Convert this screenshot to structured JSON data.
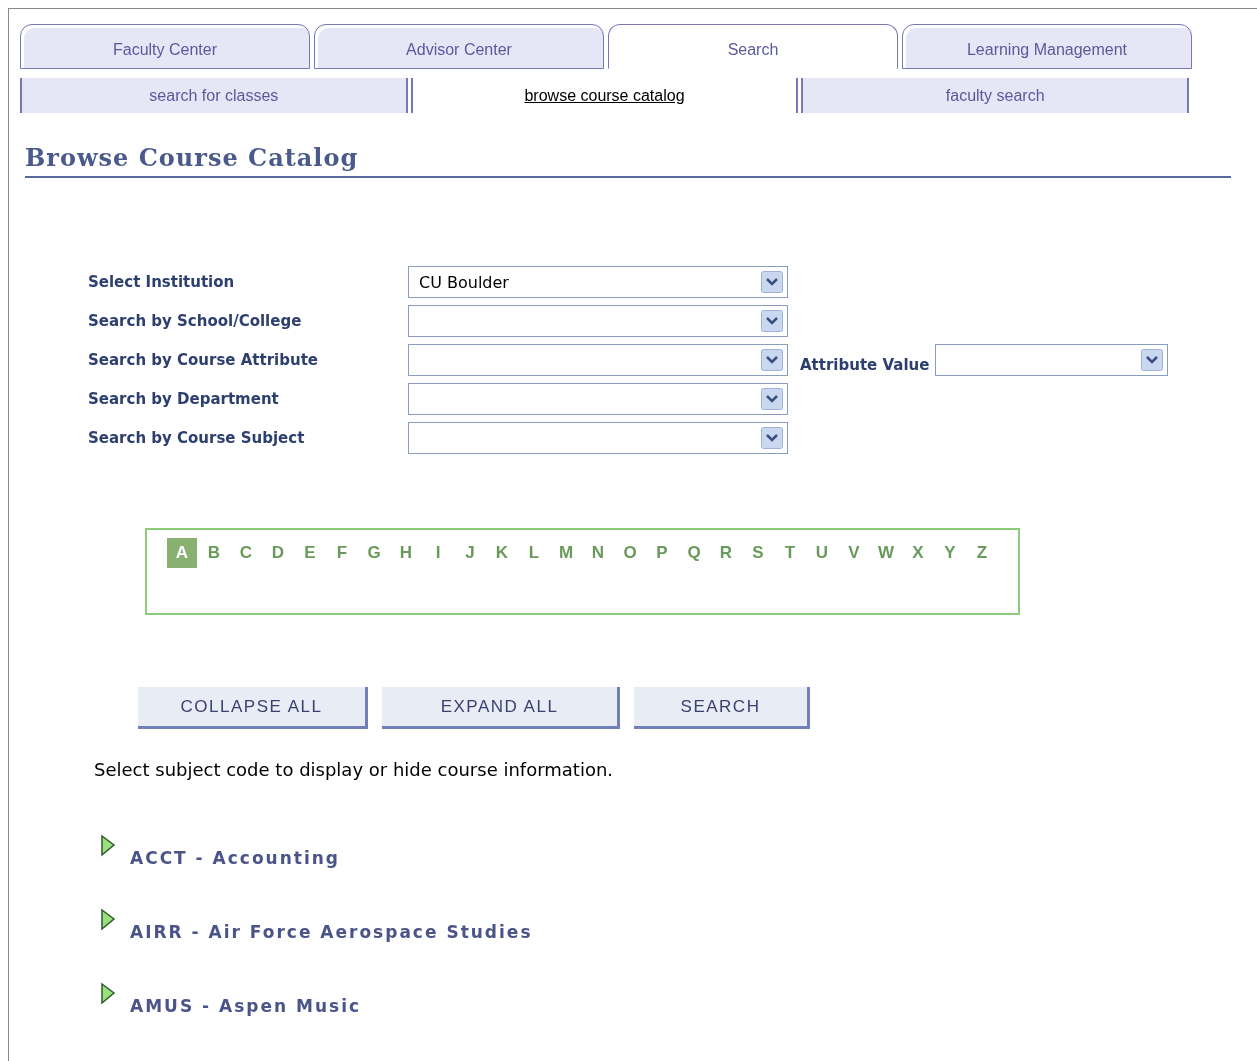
{
  "tabs": [
    {
      "label": "Faculty Center",
      "selected": false
    },
    {
      "label": "Advisor Center",
      "selected": false
    },
    {
      "label": "Search",
      "selected": true
    },
    {
      "label": "Learning Management",
      "selected": false
    }
  ],
  "subtabs": [
    {
      "label": "search for classes",
      "selected": false
    },
    {
      "label": "browse course catalog",
      "selected": true
    },
    {
      "label": "faculty search",
      "selected": false
    }
  ],
  "page_title": "Browse Course Catalog",
  "form": {
    "fields": [
      {
        "label": "Select Institution",
        "value": "CU Boulder"
      },
      {
        "label": "Search by School/College"
      },
      {
        "label": "Search by Course Attribute",
        "extra": {
          "label": "Attribute Value"
        }
      },
      {
        "label": "Search by Department"
      },
      {
        "label": "Search by Course Subject"
      }
    ]
  },
  "letters": [
    {
      "label": "A",
      "selected": true
    },
    {
      "label": "B",
      "selected": false
    },
    {
      "label": "C",
      "selected": false
    },
    {
      "label": "D",
      "selected": false
    },
    {
      "label": "E",
      "selected": false
    },
    {
      "label": "F",
      "selected": false
    },
    {
      "label": "G",
      "selected": false
    },
    {
      "label": "H",
      "selected": false
    },
    {
      "label": "I",
      "selected": false
    },
    {
      "label": "J",
      "selected": false
    },
    {
      "label": "K",
      "selected": false
    },
    {
      "label": "L",
      "selected": false
    },
    {
      "label": "M",
      "selected": false
    },
    {
      "label": "N",
      "selected": false
    },
    {
      "label": "O",
      "selected": false
    },
    {
      "label": "P",
      "selected": false
    },
    {
      "label": "Q",
      "selected": false
    },
    {
      "label": "R",
      "selected": false
    },
    {
      "label": "S",
      "selected": false
    },
    {
      "label": "T",
      "selected": false
    },
    {
      "label": "U",
      "selected": false
    },
    {
      "label": "V",
      "selected": false
    },
    {
      "label": "W",
      "selected": false
    },
    {
      "label": "X",
      "selected": false
    },
    {
      "label": "Y",
      "selected": false
    },
    {
      "label": "Z",
      "selected": false
    }
  ],
  "buttons": [
    "COLLAPSE ALL",
    "EXPAND ALL",
    "SEARCH"
  ],
  "instructions": "Select subject code to display or hide course information.",
  "subjects": [
    {
      "label": "ACCT - Accounting",
      "expanded": false
    },
    {
      "label": "AIRR - Air Force Aerospace Studies",
      "expanded": false
    },
    {
      "label": "AMUS - Aspen Music",
      "expanded": false
    }
  ]
}
